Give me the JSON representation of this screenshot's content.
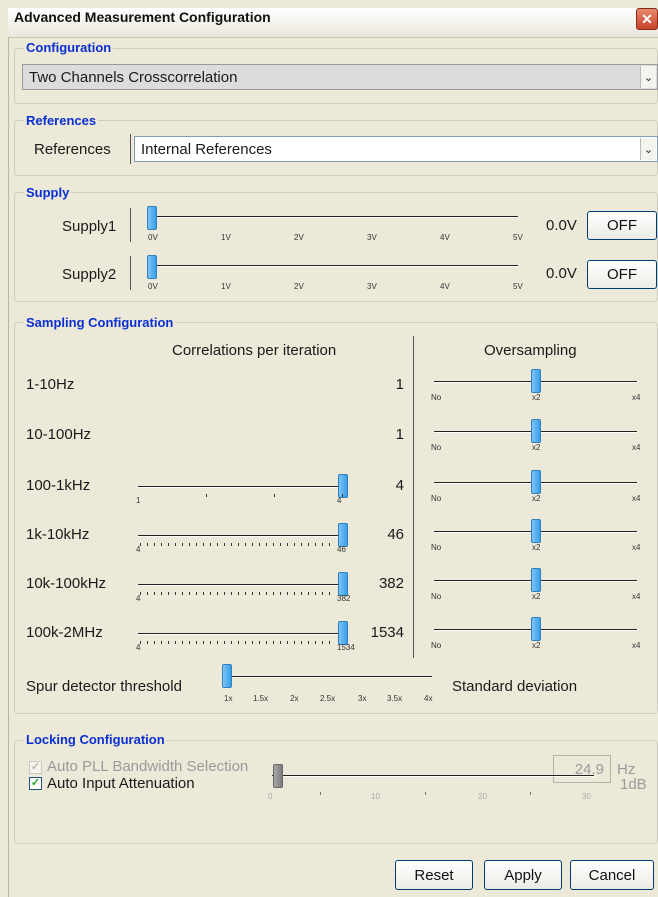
{
  "window": {
    "title": "Advanced Measurement Configuration",
    "close_glyph": "✕"
  },
  "configuration": {
    "group_title": "Configuration",
    "selected": "Two Channels Crosscorrelation",
    "dropdown_glyph": "⌄"
  },
  "references": {
    "group_title": "References",
    "label": "References",
    "selected": "Internal References",
    "dropdown_glyph": "⌄"
  },
  "supply": {
    "group_title": "Supply",
    "tick_labels": [
      "0V",
      "1V",
      "2V",
      "3V",
      "4V",
      "5V"
    ],
    "rows": [
      {
        "label": "Supply1",
        "value": "0.0V",
        "button": "OFF",
        "level": 0
      },
      {
        "label": "Supply2",
        "value": "0.0V",
        "button": "OFF",
        "level": 0
      }
    ]
  },
  "sampling": {
    "group_title": "Sampling Configuration",
    "col_correlations": "Correlations per iteration",
    "col_oversampling": "Oversampling",
    "oversampling_ticks": [
      "No",
      "x2",
      "x4"
    ],
    "rows": [
      {
        "band": "1-10Hz",
        "value": "1",
        "slider_min": "",
        "slider_max": "",
        "oversampling": "x2"
      },
      {
        "band": "10-100Hz",
        "value": "1",
        "slider_min": "",
        "slider_max": "",
        "oversampling": "x2"
      },
      {
        "band": "100-1kHz",
        "value": "4",
        "slider_min": "1",
        "slider_max": "4",
        "oversampling": "x2"
      },
      {
        "band": "1k-10kHz",
        "value": "46",
        "slider_min": "4",
        "slider_max": "46",
        "oversampling": "x2"
      },
      {
        "band": "10k-100kHz",
        "value": "382",
        "slider_min": "4",
        "slider_max": "382",
        "oversampling": "x2"
      },
      {
        "band": "100k-2MHz",
        "value": "1534",
        "slider_min": "4",
        "slider_max": "1534",
        "oversampling": "x2"
      }
    ],
    "spur": {
      "label": "Spur detector threshold",
      "right_label": "Standard deviation",
      "tick_labels": [
        "1x",
        "1.5x",
        "2x",
        "2.5x",
        "3x",
        "3.5x",
        "4x"
      ],
      "value": "1x"
    }
  },
  "locking": {
    "group_title": "Locking Configuration",
    "auto_pll_label": "Auto PLL Bandwidth Selection",
    "auto_pll_checked": true,
    "bandwidth_value": "24.9",
    "bandwidth_unit": "Hz",
    "auto_atten_label": "Auto Input Attenuation",
    "auto_atten_checked": true,
    "atten_ticks": [
      "0",
      "10",
      "20",
      "30"
    ],
    "atten_value": "1dB",
    "check_glyph": "✓"
  },
  "buttons": {
    "reset": "Reset",
    "apply": "Apply",
    "cancel": "Cancel"
  }
}
